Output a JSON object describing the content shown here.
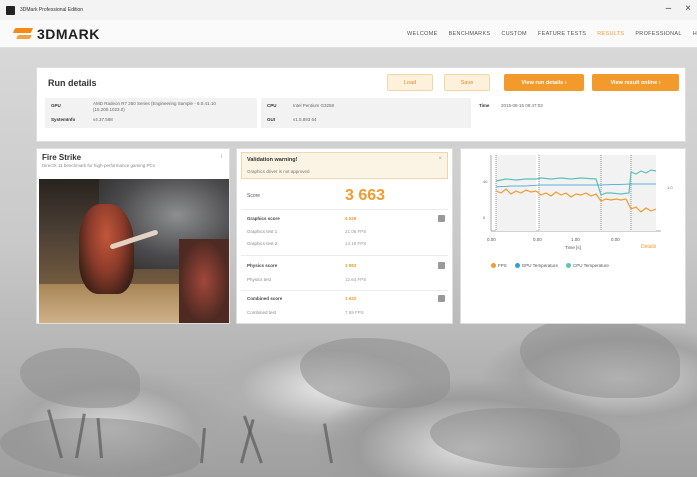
{
  "window": {
    "title": "3DMark Professional Edition",
    "minimize": "–",
    "close": "×"
  },
  "header": {
    "logo": "3DMARK",
    "nav": [
      {
        "label": "WELCOME",
        "active": false
      },
      {
        "label": "BENCHMARKS",
        "active": false
      },
      {
        "label": "CUSTOM",
        "active": false
      },
      {
        "label": "FEATURE TESTS",
        "active": false
      },
      {
        "label": "RESULTS",
        "active": true
      },
      {
        "label": "PROFESSIONAL",
        "active": false
      },
      {
        "label": "H",
        "active": false
      }
    ]
  },
  "run_details": {
    "title": "Run details",
    "buttons": {
      "load": "Load",
      "save": "Save",
      "view_run_details": "View run details ›",
      "view_result_online": "View result online ›"
    },
    "gpu_label": "GPU",
    "gpu_value": "AMD Radeon R7 250 Series (Engineering Sample - 6.0.41.10 (15.200.1023.0)",
    "cpu_label": "CPU",
    "cpu_value": "Intel Pentium G3258",
    "time_label": "Time",
    "time_value": "2015-08-15 09:47:03",
    "systeminfo_label": "SystemInfo",
    "systeminfo_value": "v4.37.588",
    "gui_label": "GUI",
    "gui_value": "v1.5.893 64"
  },
  "fire_strike": {
    "title": "Fire Strike",
    "subtitle": "DirectX 11 benchmark for high-performance gaming PCs",
    "info_icon": "i"
  },
  "score": {
    "warning_title": "Validation warning!",
    "warning_text": "Graphics driver is not approved",
    "warning_close": "×",
    "label": "Score",
    "value": "3 663",
    "graphics_score_label": "Graphics score",
    "graphics_score": "4 029",
    "graphics_test_1_label": "Graphics test 1",
    "graphics_test_1": "21.06 FPS",
    "graphics_test_2_label": "Graphics test 2",
    "graphics_test_2": "14.15 FPS",
    "physics_score_label": "Physics score",
    "physics_score": "3 983",
    "physics_test_label": "Physics test",
    "physics_test": "12.64 FPS",
    "combined_score_label": "Combined score",
    "combined_score": "1 632",
    "combined_test_label": "Combined test",
    "combined_test": "7.59 FPS"
  },
  "chart": {
    "details": "Details",
    "x_ticks": [
      "0.00",
      "0.00",
      "1.00",
      "0.00"
    ],
    "x_label": "Time [s]",
    "legend": [
      {
        "label": "FPS",
        "color": "#f39a2c"
      },
      {
        "label": "GPU Temperature",
        "color": "#2f9fd8"
      },
      {
        "label": "CPU Temperature",
        "color": "#5ec2b8"
      }
    ]
  }
}
